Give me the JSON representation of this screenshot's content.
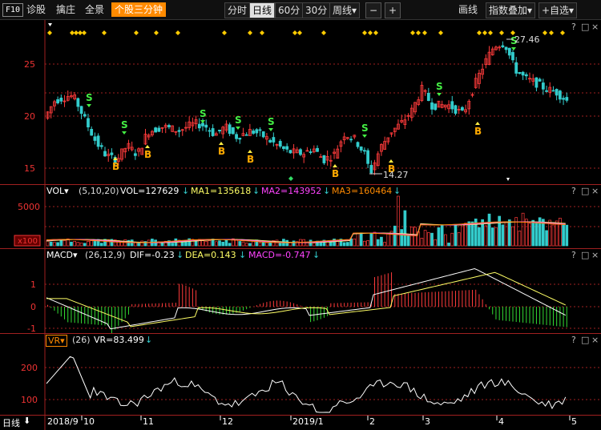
{
  "toolbar": {
    "f10": "F10",
    "diagnose": "诊股",
    "swing": "擒庄",
    "overview": "全景",
    "stock_3min": "个股三分钟",
    "periods": [
      "分时",
      "日线",
      "60分",
      "30分",
      "周线▾"
    ],
    "active_period": "日线",
    "minus": "−",
    "plus": "+",
    "draw": "画线",
    "index_overlay": "指数叠加▾",
    "add_watchlist": "+自选▾"
  },
  "colors": {
    "up": "#ff3b3b",
    "down": "#33cccc",
    "ma1": "#ffff66",
    "ma2": "#ff44ff",
    "ma3": "#ff8a00",
    "signal_s": "#44ee44",
    "signal_b": "#ffaa00",
    "diamond": "#ffcc00",
    "grid": "#a02020"
  },
  "main": {
    "y_labels": [
      "25",
      "20",
      "15"
    ],
    "high_label": "27.46",
    "low_label": "14.27",
    "s_label": "S",
    "b_label": "B",
    "window_controls": [
      "?",
      "□",
      "×"
    ]
  },
  "vol": {
    "name": "VOL▾",
    "params": "(5,10,20)",
    "vol": "VOL=127629",
    "ma1": "MA1=135618",
    "ma2": "MA2=143952",
    "ma3": "MA3=160464",
    "y_label": "5000",
    "unit": "x100",
    "window_controls": [
      "?",
      "□",
      "×"
    ]
  },
  "macd": {
    "name": "MACD▾",
    "params": "(26,12,9)",
    "dif": "DIF=-0.23",
    "dea": "DEA=0.143",
    "macd": "MACD=-0.747",
    "y_labels": [
      "1",
      "0",
      "-1"
    ],
    "window_controls": [
      "?",
      "□",
      "×"
    ]
  },
  "vr": {
    "name": "VR▾",
    "params": "(26)",
    "value": "VR=83.499",
    "y_labels": [
      "200",
      "100"
    ],
    "window_controls": [
      "?",
      "□",
      "×"
    ]
  },
  "axis": {
    "period_label": "日线",
    "months": [
      "2018/9",
      "10",
      "11",
      "12",
      "2019/1",
      "2",
      "3",
      "4",
      "5"
    ]
  }
}
